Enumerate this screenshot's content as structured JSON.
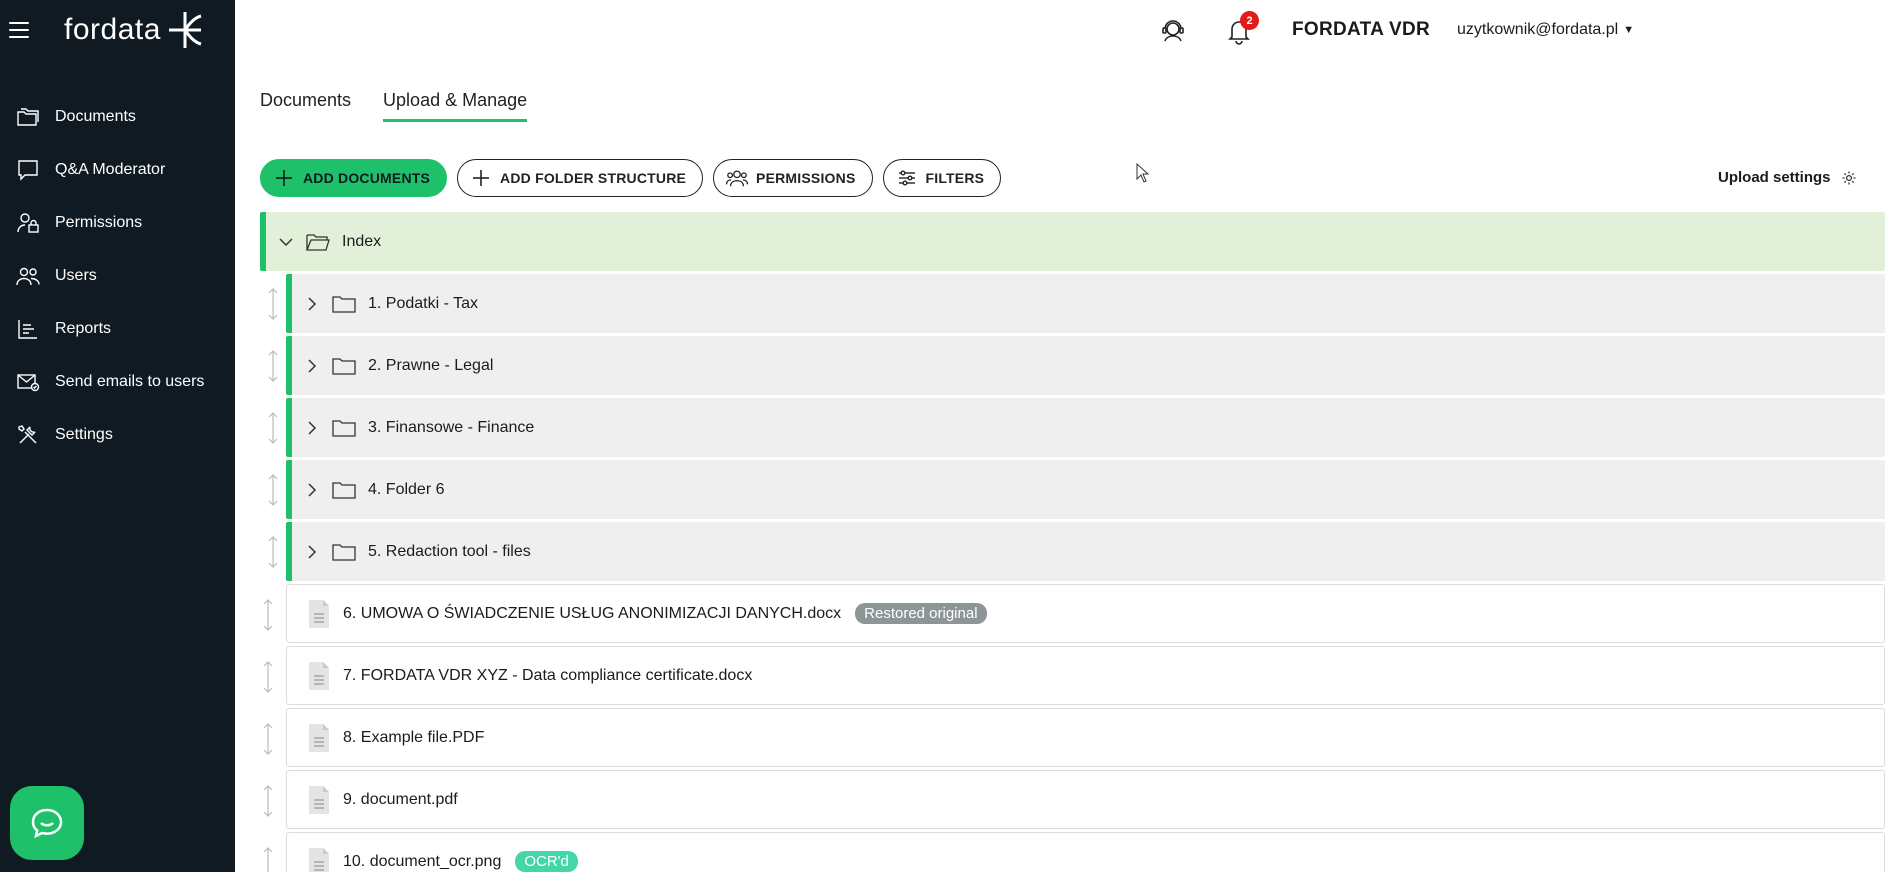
{
  "sidebar": {
    "logo": "fordata",
    "items": [
      {
        "label": "Documents",
        "icon": "folders-icon"
      },
      {
        "label": "Q&A Moderator",
        "icon": "chat-icon"
      },
      {
        "label": "Permissions",
        "icon": "user-lock-icon"
      },
      {
        "label": "Users",
        "icon": "users-icon"
      },
      {
        "label": "Reports",
        "icon": "bar-chart-icon"
      },
      {
        "label": "Send emails to users",
        "icon": "mail-icon"
      },
      {
        "label": "Settings",
        "icon": "tools-icon"
      }
    ]
  },
  "header": {
    "notification_count": "2",
    "vdr_name": "FORDATA VDR",
    "user_email": "uzytkownik@fordata.pl"
  },
  "tabs": [
    {
      "label": "Documents",
      "active": false
    },
    {
      "label": "Upload & Manage",
      "active": true
    }
  ],
  "toolbar": {
    "add_documents": "ADD DOCUMENTS",
    "add_folder_structure": "ADD FOLDER STRUCTURE",
    "permissions": "PERMISSIONS",
    "filters": "FILTERS",
    "upload_settings": "Upload settings"
  },
  "tree": {
    "root": "Index",
    "folders": [
      "1. Podatki - Tax",
      "2. Prawne - Legal",
      "3. Finansowe - Finance",
      "4. Folder 6",
      "5. Redaction tool - files"
    ],
    "files": [
      {
        "name": "6. UMOWA O ŚWIADCZENIE USŁUG ANONIMIZACJI DANYCH.docx",
        "badge": "Restored original"
      },
      {
        "name": "7. FORDATA VDR XYZ - Data compliance certificate.docx",
        "badge": ""
      },
      {
        "name": "8. Example file.PDF",
        "badge": ""
      },
      {
        "name": "9. document.pdf",
        "badge": ""
      },
      {
        "name": "10. document_ocr.png",
        "badge": "OCR'd"
      }
    ]
  },
  "colors": {
    "sidebar_bg": "#0f1a22",
    "accent_green": "#1ec16a",
    "root_row_bg": "#e2f0da",
    "folder_row_bg": "#efefef",
    "badge_gray": "#8e9596",
    "badge_teal": "#44d6a8",
    "notification_red": "#e41b1b"
  }
}
